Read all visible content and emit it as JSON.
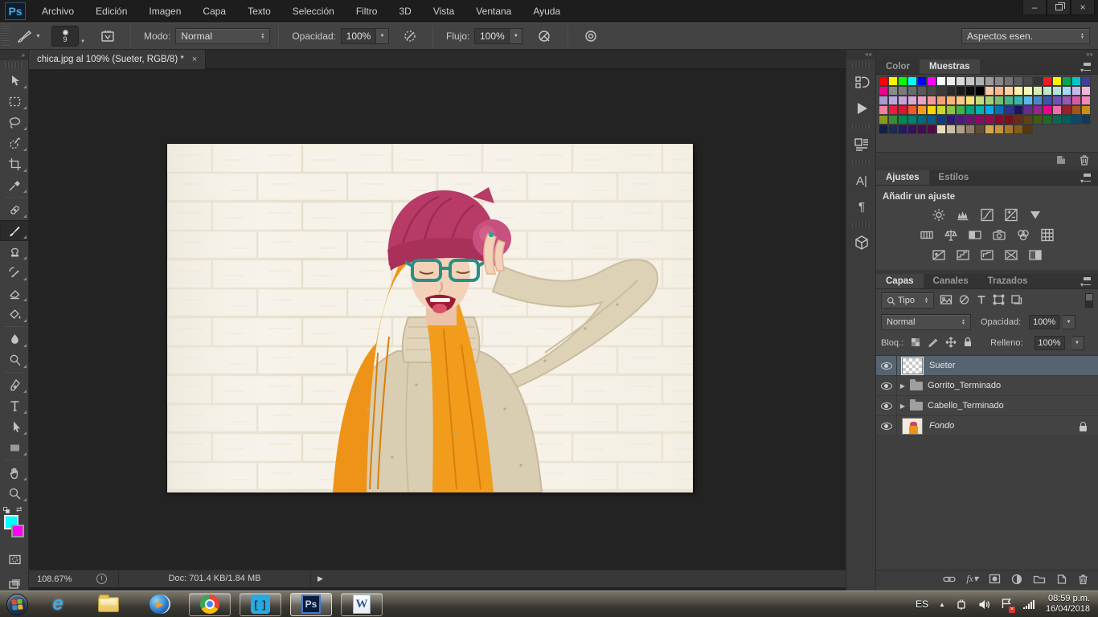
{
  "titlebar": {
    "logo": "Ps",
    "menus": [
      "Archivo",
      "Edición",
      "Imagen",
      "Capa",
      "Texto",
      "Selección",
      "Filtro",
      "3D",
      "Vista",
      "Ventana",
      "Ayuda"
    ],
    "minimize": "–",
    "close": "×"
  },
  "options": {
    "brush_size": "9",
    "modo_label": "Modo:",
    "modo_value": "Normal",
    "opacidad_label": "Opacidad:",
    "opacidad_value": "100%",
    "flujo_label": "Flujo:",
    "flujo_value": "100%",
    "workspace": "Aspectos esen."
  },
  "tabbar": {
    "title": "chica.jpg al 109% (Sueter, RGB/8) *",
    "close": "×"
  },
  "statusbar": {
    "zoom": "108.67%",
    "doc": "Doc: 701.4 KB/1.84 MB"
  },
  "panels": {
    "colors": {
      "tab_color": "Color",
      "tab_muestras": "Muestras",
      "swatch_rows": [
        [
          "#ff0000",
          "#fff200",
          "#00ff00",
          "#00ffff",
          "#0000ff",
          "#ff00ff",
          "#ffffff",
          "#ececec",
          "#d9d9d9",
          "#c4c4c4",
          "#b0b0b0",
          "#9b9b9b",
          "#878787",
          "#727272",
          "#5e5e5e",
          "#494949",
          "#353535",
          "#ed1c24",
          "#fff200",
          "#00a651",
          "#00c8c8",
          "#3f3fa0"
        ],
        [
          "#ec008c",
          "#8a8a8a",
          "#7a7a7a",
          "#6a6a6a",
          "#5a5a5a",
          "#4a4a4a",
          "#3a3a3a",
          "#2a2a2a",
          "#1a1a1a",
          "#0d0d0d",
          "#000000",
          "#ffc9a0",
          "#ffb68f",
          "#ffd0a0",
          "#fff0a8",
          "#f4f7b8",
          "#d8efb0",
          "#bfe8c8",
          "#b0e4dc",
          "#a8d8f0",
          "#c8b8ec",
          "#f0b8d8"
        ],
        [
          "#a89ad8",
          "#b8a8e0",
          "#c8a0dc",
          "#d8a8d8",
          "#eca0c8",
          "#f49898",
          "#f4a070",
          "#f8b478",
          "#fcc888",
          "#f8e070",
          "#c8dc78",
          "#a0d078",
          "#70c070",
          "#40b888",
          "#30b8b0",
          "#58b8e8",
          "#4888d0",
          "#3858b0",
          "#7050b8",
          "#9858b8",
          "#d858a8",
          "#f088b8"
        ],
        [
          "#f4809c",
          "#ec1c40",
          "#d81830",
          "#f05a28",
          "#f49a20",
          "#f8d800",
          "#cada28",
          "#8cc63f",
          "#39b54a",
          "#00a779",
          "#00b3b3",
          "#00aeef",
          "#0072bc",
          "#2e3192",
          "#1b1464",
          "#662d91",
          "#92278f",
          "#ec008c",
          "#f06eaa",
          "#9e1f28",
          "#a0561c",
          "#c89018"
        ],
        [
          "#8a9a20",
          "#3a8a3a",
          "#008a50",
          "#008070",
          "#006a7a",
          "#0a5a8a",
          "#123a7a",
          "#2a1a72",
          "#4a1a7a",
          "#6a1470",
          "#8a0a66",
          "#980850",
          "#880830",
          "#780f1c",
          "#6a2a14",
          "#5a4414",
          "#3e5c14",
          "#1e6a2a",
          "#0a6a4e",
          "#006060",
          "#0a4a6a",
          "#123a58"
        ],
        [
          "#142040",
          "#1a2a55",
          "#241a5e",
          "#34125a",
          "#420e50",
          "#520a44",
          "#e8dcc0",
          "#ccc0a8",
          "#b0a088",
          "#907c64",
          "#5e4c38",
          "#d8a850",
          "#c89440",
          "#a87828",
          "#885c14",
          "#55380e"
        ]
      ]
    },
    "ajustes": {
      "tab_ajustes": "Ajustes",
      "tab_estilos": "Estilos",
      "heading": "Añadir un ajuste"
    },
    "capas": {
      "tab_capas": "Capas",
      "tab_canales": "Canales",
      "tab_trazados": "Trazados",
      "filtro_value": "Tipo",
      "blend_value": "Normal",
      "opacidad_label": "Opacidad:",
      "opacidad_value": "100%",
      "bloq_label": "Bloq.:",
      "relleno_label": "Relleno:",
      "relleno_value": "100%",
      "layers": [
        {
          "name": "Sueter",
          "type": "layer",
          "selected": true
        },
        {
          "name": "Gorrito_Terminado",
          "type": "group",
          "selected": false
        },
        {
          "name": "Cabello_Terminado",
          "type": "group",
          "selected": false
        },
        {
          "name": "Fondo",
          "type": "background",
          "selected": false,
          "locked": true
        }
      ]
    }
  },
  "taskbar": {
    "lang": "ES",
    "time": "08:59 p.m.",
    "date": "16/04/2018"
  },
  "accents": {
    "foreground_color": "#00ffff",
    "background_color": "#ff00ff"
  }
}
